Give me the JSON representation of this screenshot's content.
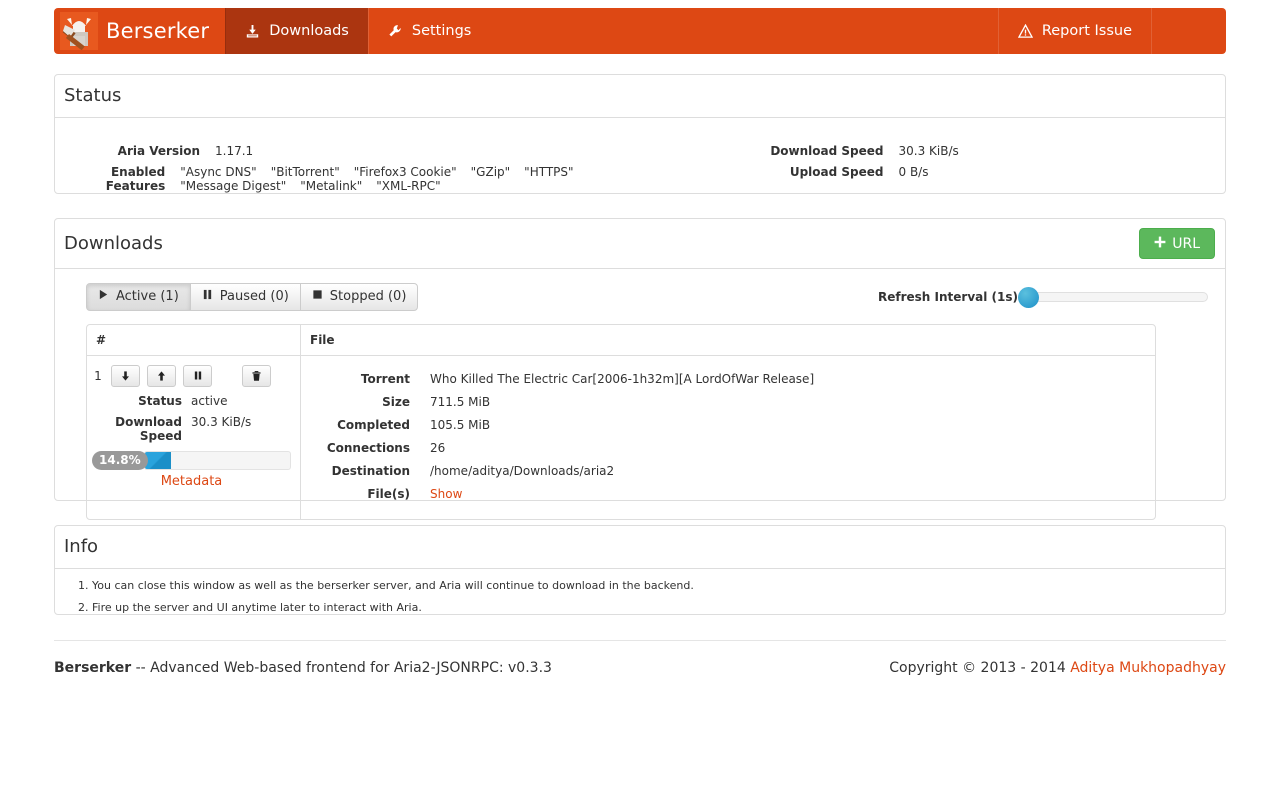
{
  "navbar": {
    "brand": "Berserker",
    "brand_logo_icon": "berserker-viking-logo",
    "items": [
      {
        "label": "Downloads",
        "icon": "download-icon",
        "active": true
      },
      {
        "label": "Settings",
        "icon": "wrench-icon",
        "active": false
      }
    ],
    "report": {
      "label": "Report Issue",
      "icon": "warning-triangle-icon"
    },
    "bg_color": "#dd4814",
    "active_bg_color": "#ab3510"
  },
  "status": {
    "title": "Status",
    "aria_version_label": "Aria Version",
    "aria_version_value": "1.17.1",
    "enabled_features_label": "Enabled Features",
    "enabled_features": [
      "\"Async DNS\"",
      "\"BitTorrent\"",
      "\"Firefox3 Cookie\"",
      "\"GZip\"",
      "\"HTTPS\"",
      "\"Message Digest\"",
      "\"Metalink\"",
      "\"XML-RPC\""
    ],
    "download_speed_label": "Download Speed",
    "download_speed_value": "30.3 KiB/s",
    "upload_speed_label": "Upload Speed",
    "upload_speed_value": "0 B/s"
  },
  "downloads": {
    "title": "Downloads",
    "add_url_label": "URL",
    "add_url_icon": "plus-icon",
    "add_url_color": "#5cb85c",
    "filters": [
      {
        "label": "Active (1)",
        "icon": "play-icon",
        "selected": true
      },
      {
        "label": "Paused (0)",
        "icon": "pause-icon",
        "selected": false
      },
      {
        "label": "Stopped (0)",
        "icon": "stop-icon",
        "selected": false
      }
    ],
    "refresh_label": "Refresh Interval (1s)",
    "refresh_value": 1,
    "table": {
      "headers": [
        "#",
        "File"
      ],
      "row": {
        "index": "1",
        "actions": [
          {
            "name": "move-down-button",
            "icon": "arrow-down-icon"
          },
          {
            "name": "move-up-button",
            "icon": "arrow-up-icon"
          },
          {
            "name": "pause-button",
            "icon": "pause-icon"
          },
          {
            "name": "remove-button",
            "icon": "trash-icon"
          }
        ],
        "status_label": "Status",
        "status_value": "active",
        "speed_label": "Download Speed",
        "speed_value": "30.3 KiB/s",
        "progress_percent": "14.8%",
        "progress_value": 14.8,
        "metadata_label": "Metadata",
        "details": [
          {
            "label": "Torrent",
            "value": "Who Killed The Electric Car[2006-1h32m][A LordOfWar Release]",
            "link": false
          },
          {
            "label": "Size",
            "value": "711.5 MiB",
            "link": false
          },
          {
            "label": "Completed",
            "value": "105.5 MiB",
            "link": false
          },
          {
            "label": "Connections",
            "value": "26",
            "link": false
          },
          {
            "label": "Destination",
            "value": "/home/aditya/Downloads/aria2",
            "link": false
          },
          {
            "label": "File(s)",
            "value": "Show",
            "link": true
          }
        ]
      }
    }
  },
  "info": {
    "title": "Info",
    "items": [
      "You can close this window as well as the berserker server, and Aria will continue to download in the backend.",
      "Fire up the server and UI anytime later to interact with Aria."
    ]
  },
  "footer": {
    "brand": "Berserker",
    "tagline": " -- Advanced Web-based frontend for Aria2-JSONRPC: v0.3.3",
    "copyright": "Copyright © 2013 - 2014 ",
    "author": "Aditya Mukhopadhyay"
  }
}
